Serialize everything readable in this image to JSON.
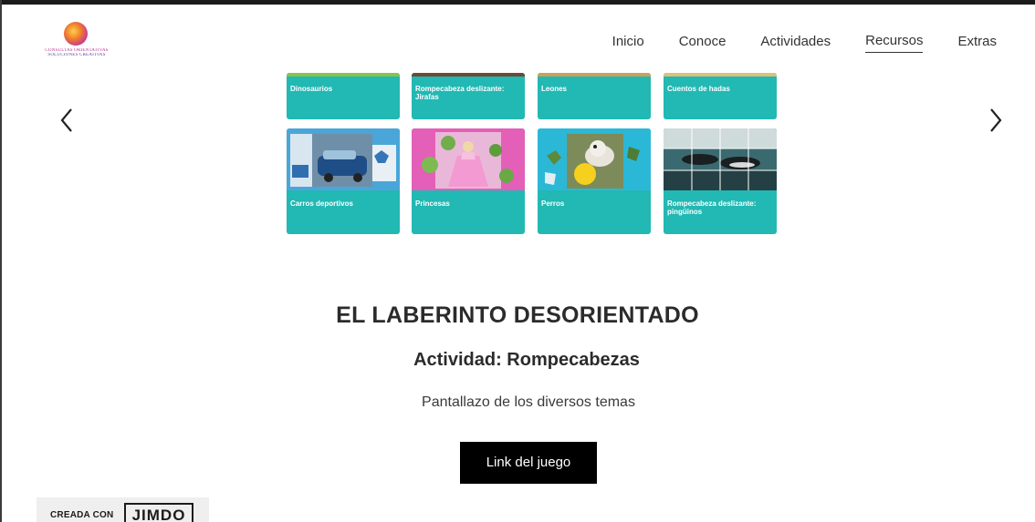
{
  "header": {
    "logo_line1": "CONSULTAS ORIENTATIVAS",
    "logo_line2": "SOLUCIONES CREATIVAS",
    "nav": [
      {
        "label": "Inicio"
      },
      {
        "label": "Conoce"
      },
      {
        "label": "Actividades"
      },
      {
        "label": "Recursos",
        "active": true
      },
      {
        "label": "Extras"
      }
    ]
  },
  "carousel": {
    "prev_icon": "chevron-left-icon",
    "next_icon": "chevron-right-icon",
    "tiles_row1": [
      {
        "label": "Dinosaurios"
      },
      {
        "label": "Rompecabeza deslizante: Jirafas"
      },
      {
        "label": "Leones"
      },
      {
        "label": "Cuentos de hadas"
      }
    ],
    "tiles_row2": [
      {
        "label": "Carros deportivos"
      },
      {
        "label": "Princesas"
      },
      {
        "label": "Perros"
      },
      {
        "label": "Rompecabeza deslizante: pingüinos"
      }
    ]
  },
  "main": {
    "title": "EL LABERINTO DESORIENTADO",
    "subtitle": "Actividad: Rompecabezas",
    "description": "Pantallazo de los diversos temas",
    "button_label": "Link del juego"
  },
  "badge": {
    "prefix": "CREADA CON",
    "brand": "JIMDO"
  },
  "colors": {
    "tile": "#22b8b3",
    "button": "#000000",
    "text": "#2b2b2b"
  }
}
